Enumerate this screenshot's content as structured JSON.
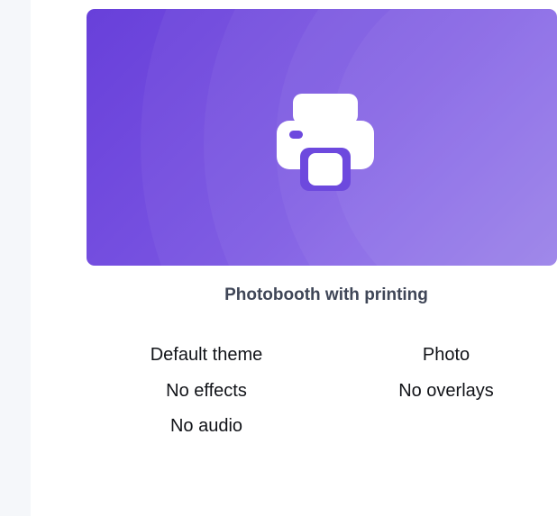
{
  "card": {
    "title": "Photobooth with printing",
    "icon": "printer-icon",
    "accent": "#6a45dc",
    "features": [
      "Default theme",
      "Photo",
      "No effects",
      "No overlays",
      "No audio"
    ]
  }
}
